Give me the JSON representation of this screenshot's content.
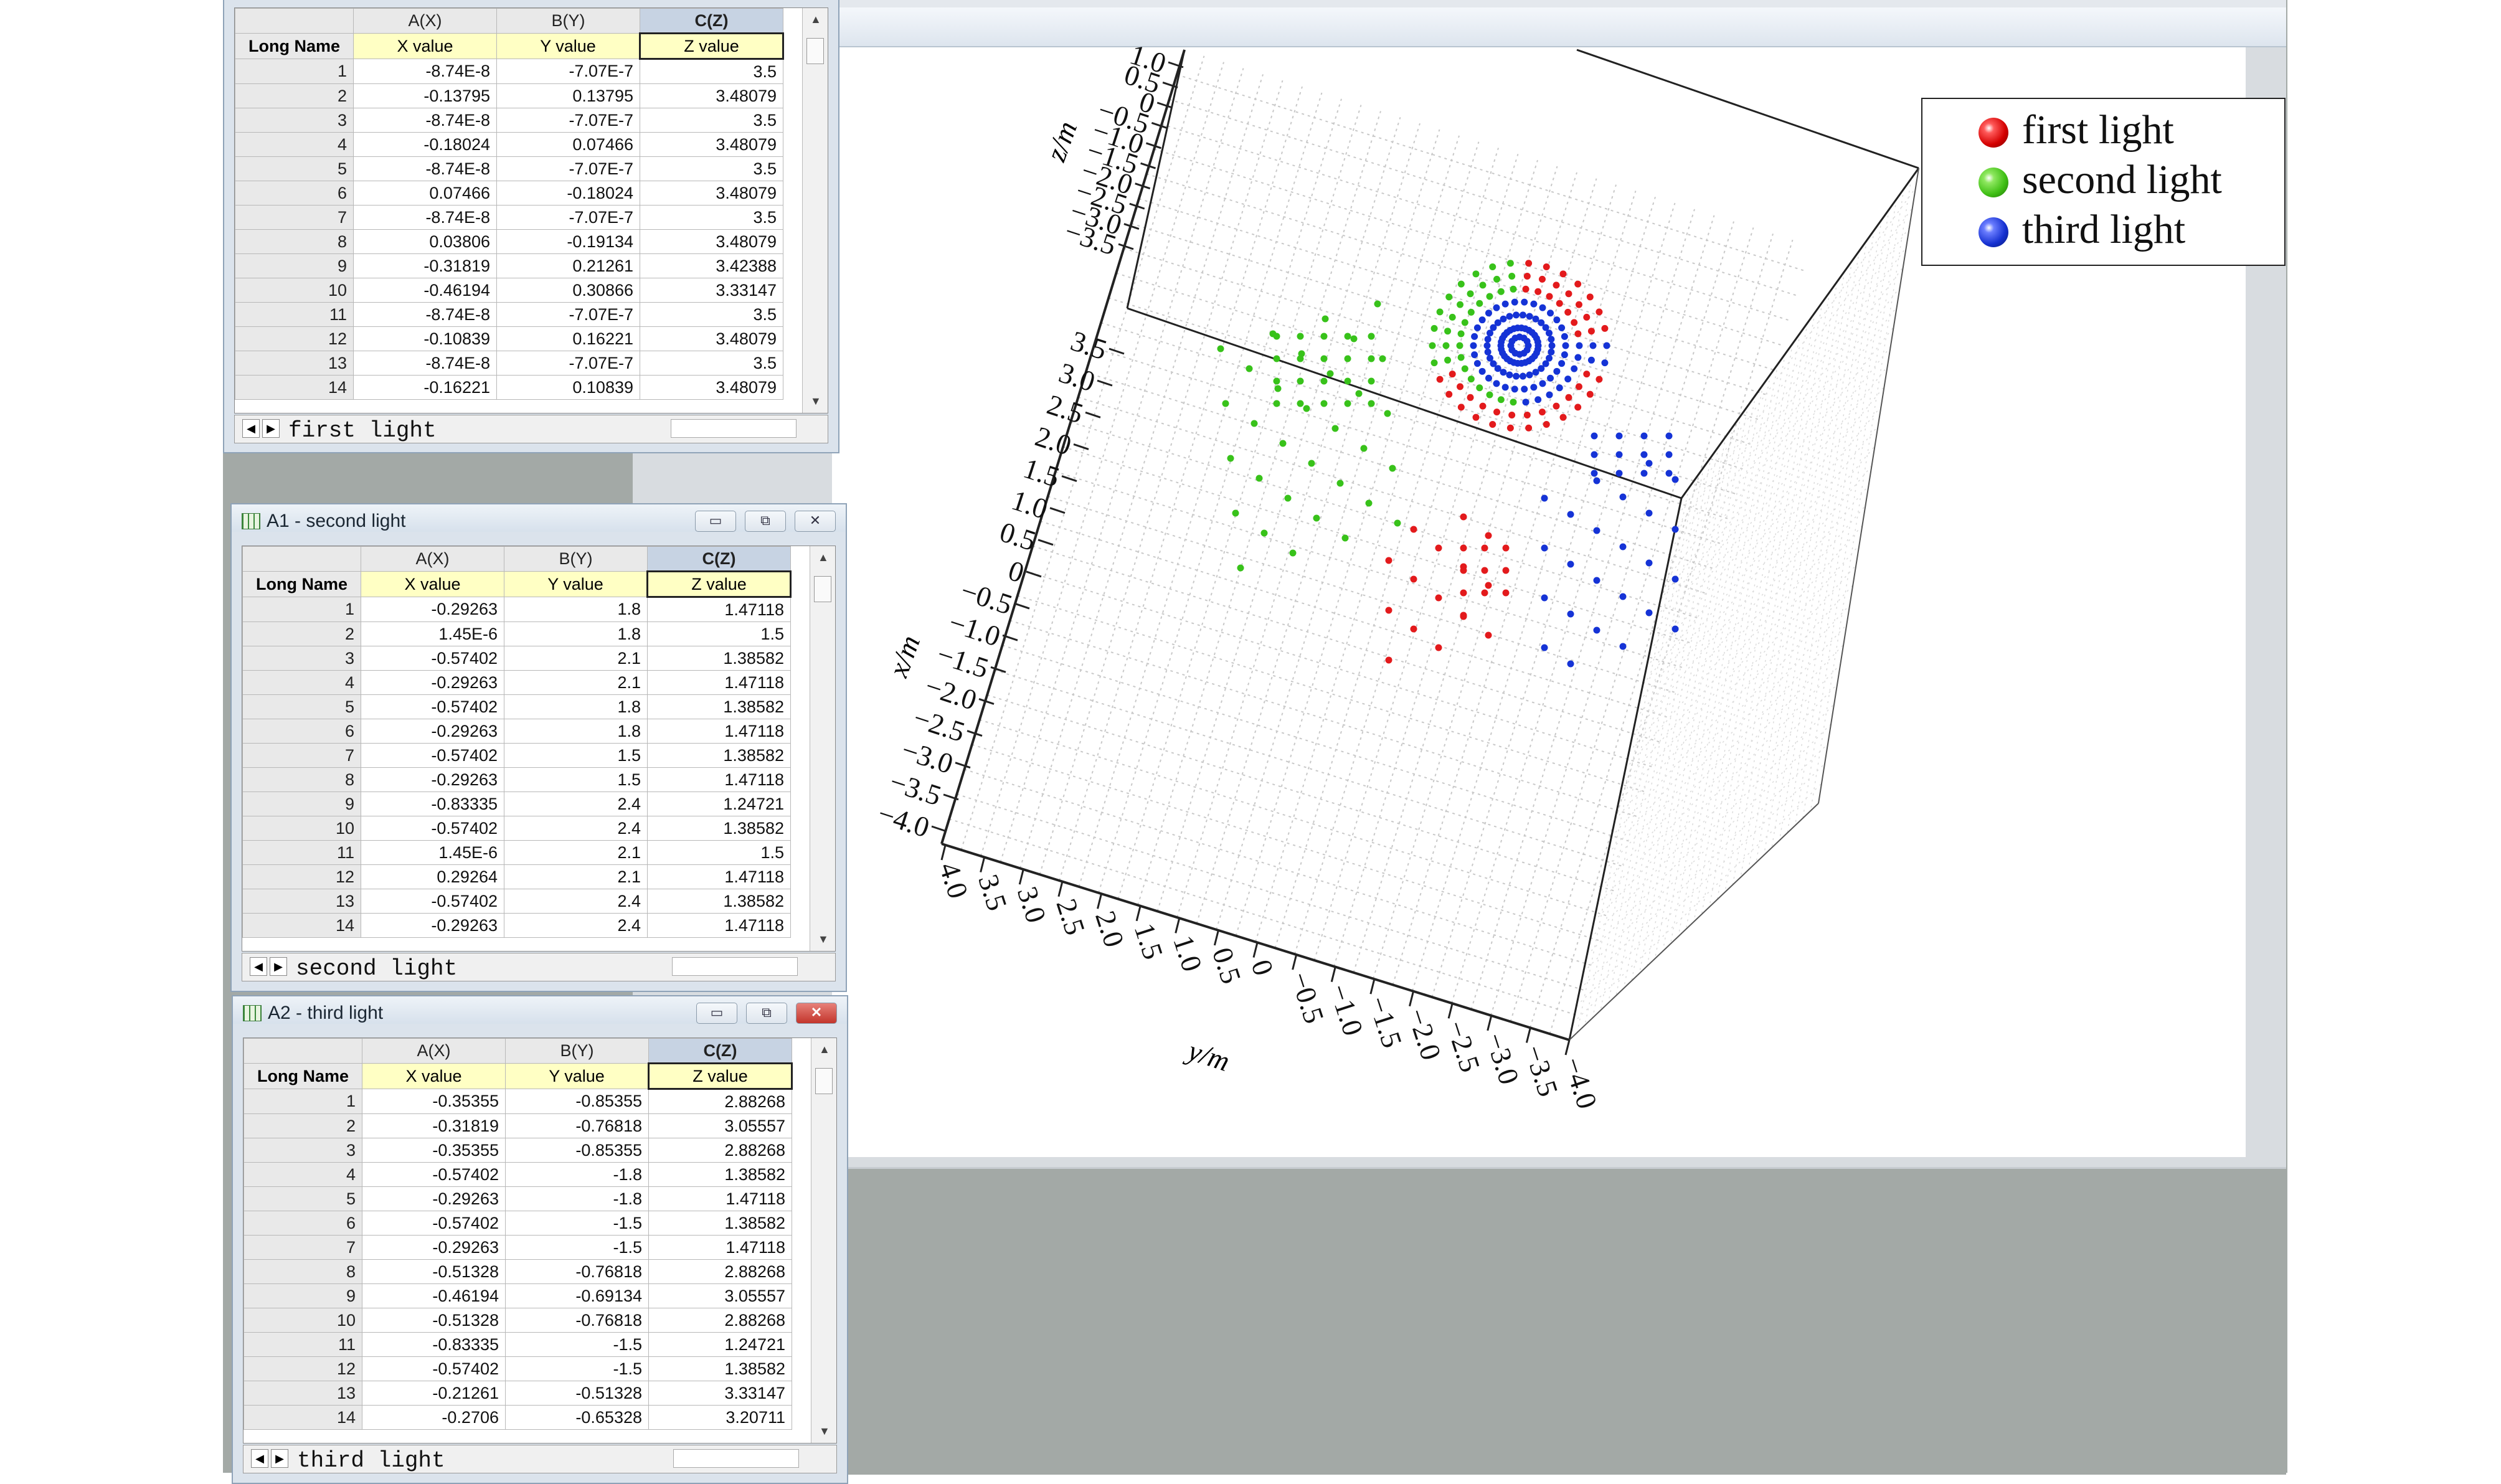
{
  "graph": {
    "legend": [
      {
        "label": "first light",
        "color": "#e31a1c"
      },
      {
        "label": "second light",
        "color": "#38c21a"
      },
      {
        "label": "third light",
        "color": "#1533d6"
      }
    ],
    "axes": {
      "z": {
        "label": "z/m",
        "ticks": [
          "1.0",
          "0.5",
          "0",
          "−0.5",
          "−1.0",
          "−1.5",
          "−2.0",
          "−2.5",
          "−3.0",
          "−3.5"
        ]
      },
      "x": {
        "label": "x/m",
        "ticks": [
          "3.5",
          "3.0",
          "2.5",
          "2.0",
          "1.5",
          "1.0",
          "0.5",
          "0",
          "−0.5",
          "−1.0",
          "−1.5",
          "−2.0",
          "−2.5",
          "−3.0",
          "−3.5",
          "−4.0"
        ]
      },
      "y": {
        "label": "y/m",
        "ticks": [
          "4.0",
          "3.5",
          "3.0",
          "2.5",
          "2.0",
          "1.5",
          "1.0",
          "0.5",
          "0",
          "−0.5",
          "−1.0",
          "−1.5",
          "−2.0",
          "−2.5",
          "−3.0",
          "−3.5",
          "−4.0"
        ]
      }
    }
  },
  "windows": [
    {
      "title": "",
      "tab": "first light",
      "columns": [
        "A(X)",
        "B(Y)",
        "C(Z)"
      ],
      "long_name_header": "Long Name",
      "units": [
        "X value",
        "Y value",
        "Z value"
      ],
      "rows": [
        [
          "1",
          "-8.74E-8",
          "-7.07E-7",
          "3.5"
        ],
        [
          "2",
          "-0.13795",
          "0.13795",
          "3.48079"
        ],
        [
          "3",
          "-8.74E-8",
          "-7.07E-7",
          "3.5"
        ],
        [
          "4",
          "-0.18024",
          "0.07466",
          "3.48079"
        ],
        [
          "5",
          "-8.74E-8",
          "-7.07E-7",
          "3.5"
        ],
        [
          "6",
          "0.07466",
          "-0.18024",
          "3.48079"
        ],
        [
          "7",
          "-8.74E-8",
          "-7.07E-7",
          "3.5"
        ],
        [
          "8",
          "0.03806",
          "-0.19134",
          "3.48079"
        ],
        [
          "9",
          "-0.31819",
          "0.21261",
          "3.42388"
        ],
        [
          "10",
          "-0.46194",
          "0.30866",
          "3.33147"
        ],
        [
          "11",
          "-8.74E-8",
          "-7.07E-7",
          "3.5"
        ],
        [
          "12",
          "-0.10839",
          "0.16221",
          "3.48079"
        ],
        [
          "13",
          "-8.74E-8",
          "-7.07E-7",
          "3.5"
        ],
        [
          "14",
          "-0.16221",
          "0.10839",
          "3.48079"
        ]
      ]
    },
    {
      "title": "A1 - second light",
      "tab": "second light",
      "columns": [
        "A(X)",
        "B(Y)",
        "C(Z)"
      ],
      "long_name_header": "Long Name",
      "units": [
        "X value",
        "Y value",
        "Z value"
      ],
      "rows": [
        [
          "1",
          "-0.29263",
          "1.8",
          "1.47118"
        ],
        [
          "2",
          "1.45E-6",
          "1.8",
          "1.5"
        ],
        [
          "3",
          "-0.57402",
          "2.1",
          "1.38582"
        ],
        [
          "4",
          "-0.29263",
          "2.1",
          "1.47118"
        ],
        [
          "5",
          "-0.57402",
          "1.8",
          "1.38582"
        ],
        [
          "6",
          "-0.29263",
          "1.8",
          "1.47118"
        ],
        [
          "7",
          "-0.57402",
          "1.5",
          "1.38582"
        ],
        [
          "8",
          "-0.29263",
          "1.5",
          "1.47118"
        ],
        [
          "9",
          "-0.83335",
          "2.4",
          "1.24721"
        ],
        [
          "10",
          "-0.57402",
          "2.4",
          "1.38582"
        ],
        [
          "11",
          "1.45E-6",
          "2.1",
          "1.5"
        ],
        [
          "12",
          "0.29264",
          "2.1",
          "1.47118"
        ],
        [
          "13",
          "-0.57402",
          "2.4",
          "1.38582"
        ],
        [
          "14",
          "-0.29263",
          "2.4",
          "1.47118"
        ]
      ]
    },
    {
      "title": "A2 - third light",
      "tab": "third light",
      "columns": [
        "A(X)",
        "B(Y)",
        "C(Z)"
      ],
      "long_name_header": "Long Name",
      "units": [
        "X value",
        "Y value",
        "Z value"
      ],
      "rows": [
        [
          "1",
          "-0.35355",
          "-0.85355",
          "2.88268"
        ],
        [
          "2",
          "-0.31819",
          "-0.76818",
          "3.05557"
        ],
        [
          "3",
          "-0.35355",
          "-0.85355",
          "2.88268"
        ],
        [
          "4",
          "-0.57402",
          "-1.8",
          "1.38582"
        ],
        [
          "5",
          "-0.29263",
          "-1.8",
          "1.47118"
        ],
        [
          "6",
          "-0.57402",
          "-1.5",
          "1.38582"
        ],
        [
          "7",
          "-0.29263",
          "-1.5",
          "1.47118"
        ],
        [
          "8",
          "-0.51328",
          "-0.76818",
          "2.88268"
        ],
        [
          "9",
          "-0.46194",
          "-0.69134",
          "3.05557"
        ],
        [
          "10",
          "-0.51328",
          "-0.76818",
          "2.88268"
        ],
        [
          "11",
          "-0.83335",
          "-1.5",
          "1.24721"
        ],
        [
          "12",
          "-0.57402",
          "-1.5",
          "1.38582"
        ],
        [
          "13",
          "-0.21261",
          "-0.51328",
          "3.33147"
        ],
        [
          "14",
          "-0.2706",
          "-0.65328",
          "3.20711"
        ]
      ]
    }
  ]
}
